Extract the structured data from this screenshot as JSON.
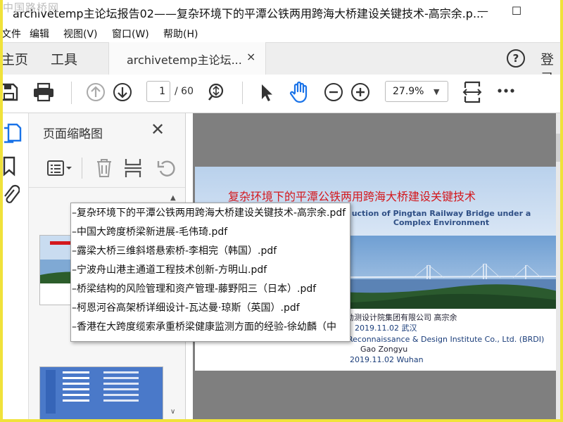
{
  "watermark": "中国路桥网",
  "window": {
    "title": "archivetemp主论坛报告02——复杂环境下的平潭公铁两用跨海大桥建设关键技术-高宗余.p...",
    "minimize": "—",
    "maximize": "☐"
  },
  "menu": {
    "items": [
      "文件",
      "编辑",
      "视图(V)",
      "窗口(W)",
      "帮助(H)"
    ]
  },
  "tabs": {
    "home": "主页",
    "tools": "工具",
    "document_tab": "archivetemp主论坛...",
    "close": "×",
    "help": "?",
    "login": "登录"
  },
  "toolbar": {
    "current_page": "1",
    "total_pages": "/ 60",
    "zoom": "27.9%"
  },
  "thumbnails_panel": {
    "title": "页面缩略图",
    "close": "✕"
  },
  "slide": {
    "title_cn": "复杂环境下的平潭公铁两用跨海大桥建设关键技术",
    "title_en": "uction of Pingtan Railway Bridge under a Complex Environment",
    "org_cn": "勘测设计院集团有限公司  高宗余",
    "date_cn": "2019.11.02  武汉",
    "org_en": "Reconnaissance & Design Institute Co., Ltd. (BRDI)",
    "author_en": "Gao Zongyu",
    "date_en": "2019.11.02  Wuhan"
  },
  "popup": {
    "items": [
      "–复杂环境下的平潭公铁两用跨海大桥建设关键技术-高宗余.pdf",
      "–中国大跨度桥梁新进展-毛伟琦.pdf",
      "–露梁大桥三维斜塔悬索桥-李相完（韩国）.pdf",
      "–宁波舟山港主通道工程技术创新-方明山.pdf",
      "–桥梁结构的风险管理和资产管理-藤野阳三（日本）.pdf",
      "–柯恩河谷高架桥详细设计-瓦达曼·琼斯（英国）.pdf",
      "–香港在大跨度缆索承重桥梁健康监测方面的经验-徐幼麟（中"
    ]
  },
  "colors": {
    "frame": "#f0e23a",
    "slide_title": "#d4171c",
    "accent_blue": "#1a73e8"
  }
}
